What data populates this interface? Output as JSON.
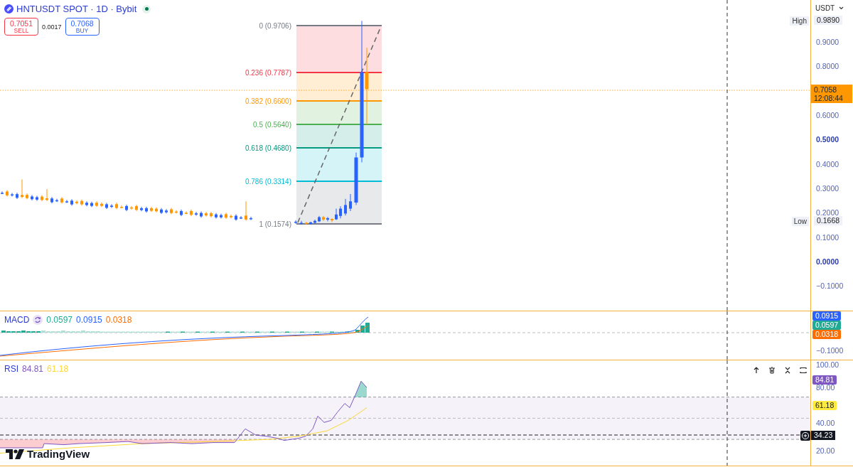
{
  "header": {
    "symbol": "HNTUSDT SPOT · 1D · Bybit",
    "market_open": true
  },
  "trade": {
    "sell_price": "0.7051",
    "sell_label": "SELL",
    "spread": "0.0017",
    "buy_price": "0.7068",
    "buy_label": "BUY"
  },
  "price_axis": {
    "currency": "USDT",
    "ticks": [
      {
        "label": "0.9000",
        "major": false
      },
      {
        "label": "0.8000",
        "major": false
      },
      {
        "label": "0.6000",
        "major": false
      },
      {
        "label": "0.5000",
        "major": true
      },
      {
        "label": "0.4000",
        "major": false
      },
      {
        "label": "0.3000",
        "major": false
      },
      {
        "label": "0.2000",
        "major": false
      },
      {
        "label": "0.1000",
        "major": false
      },
      {
        "label": "0.0000",
        "major": true
      },
      {
        "label": "−0.1000",
        "major": false
      }
    ],
    "high": {
      "label": "High",
      "value": "0.9890"
    },
    "low": {
      "label": "Low",
      "value": "0.1668"
    },
    "last": {
      "price": "0.7058",
      "countdown": "12:08:44"
    }
  },
  "fib_levels": [
    {
      "label": "0 (0.9706)",
      "color": "#787b86"
    },
    {
      "label": "0.236 (0.7787)",
      "color": "#f23645"
    },
    {
      "label": "0.382 (0.6600)",
      "color": "#ff9800"
    },
    {
      "label": "0.5 (0.5640)",
      "color": "#4caf50"
    },
    {
      "label": "0.618 (0.4680)",
      "color": "#089981"
    },
    {
      "label": "0.786 (0.3314)",
      "color": "#00bcd4"
    },
    {
      "label": "1 (0.1574)",
      "color": "#787b86"
    }
  ],
  "macd": {
    "title": "MACD",
    "values": [
      {
        "text": "0.0597",
        "color": "#22ab94"
      },
      {
        "text": "0.0915",
        "color": "#2962ff"
      },
      {
        "text": "0.0318",
        "color": "#ff6d00"
      }
    ],
    "tags": [
      {
        "text": "0.0915",
        "color": "#2962ff"
      },
      {
        "text": "0.0597",
        "color": "#22ab94"
      },
      {
        "text": "0.0318",
        "color": "#ff6d00"
      }
    ],
    "ticks": [
      "−0.1000"
    ]
  },
  "rsi": {
    "title": "RSI",
    "values": [
      {
        "text": "84.81",
        "color": "#7e57c2"
      },
      {
        "text": "61.18",
        "color": "#fdd835"
      }
    ],
    "ticks": [
      "100.00",
      "80.00",
      "40.00",
      "20.00"
    ],
    "tags": [
      {
        "text": "84.81",
        "color": "#7e57c2"
      },
      {
        "text": "61.18",
        "color": "#ffeb3b"
      }
    ],
    "crosshair_value": "34.23"
  },
  "branding": "TradingView"
}
